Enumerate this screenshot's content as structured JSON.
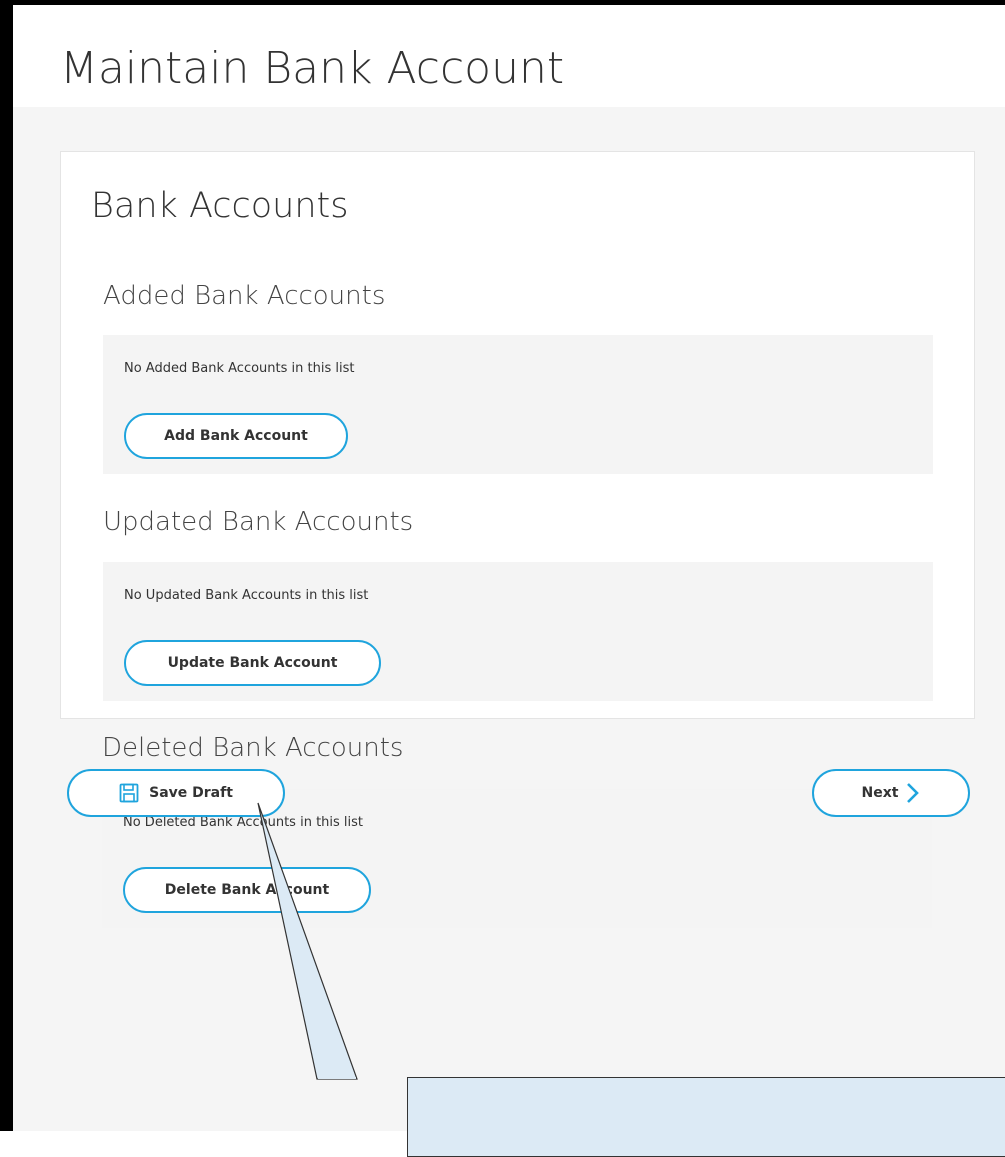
{
  "page": {
    "title": "Maintain Bank Account"
  },
  "card": {
    "title": "Bank Accounts",
    "sections": {
      "added": {
        "title": "Added Bank Accounts",
        "empty_message": "No Added Bank Accounts in this list",
        "button_label": "Add Bank Account"
      },
      "updated": {
        "title": "Updated Bank Accounts",
        "empty_message": "No Updated Bank Accounts in this list",
        "button_label": "Update Bank Account"
      },
      "deleted": {
        "title": "Deleted Bank Accounts",
        "empty_message": "No Deleted Bank Accounts in this list",
        "button_label": "Delete Bank Account"
      }
    }
  },
  "footer": {
    "save_draft_label": "Save Draft",
    "save_draft_icon": "floppy-disk-icon",
    "next_label": "Next",
    "next_icon": "chevron-right-icon"
  },
  "colors": {
    "accent": "#1fa4dd",
    "background": "#f5f5f5",
    "panel": "#f4f4f4",
    "text": "#333333",
    "callout": "#dceaf5"
  }
}
